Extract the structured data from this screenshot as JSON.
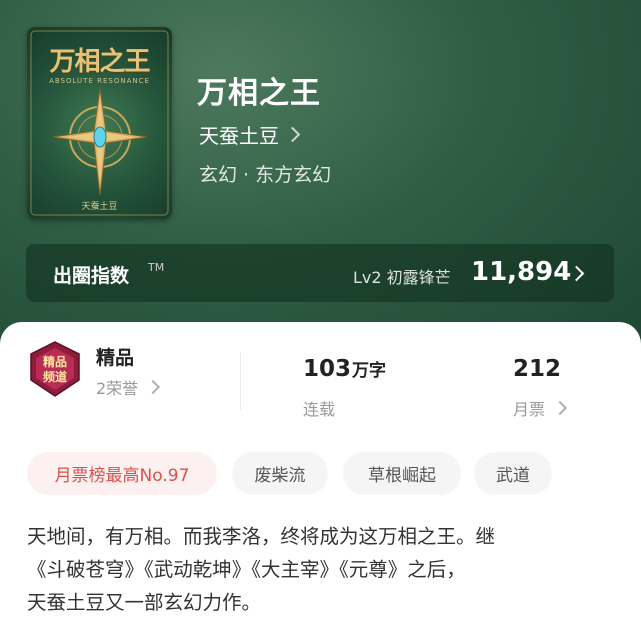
{
  "book": {
    "cover": {
      "title_art": "万相之王",
      "subtitle_art": "ABSOLUTE RESONANCE",
      "author_art": "天蚕土豆"
    },
    "title": "万相之王",
    "author": "天蚕土豆",
    "genre": "玄幻 · 东方玄幻"
  },
  "index_bar": {
    "label": "出圈指数",
    "tm": "TM",
    "level": "Lv2 初露锋芒",
    "value": "11,894"
  },
  "stats": {
    "quality": {
      "name": "精品",
      "honor": "2荣誉",
      "badge_text": "精品频道"
    },
    "word_count": {
      "number": "103",
      "unit": "万字",
      "status": "连载"
    },
    "monthly_ticket": {
      "value": "212",
      "label": "月票"
    }
  },
  "tags": [
    "月票榜最高No.97",
    "废柴流",
    "草根崛起",
    "武道"
  ],
  "intro_lines": [
    "天地间，有万相。而我李洛，终将成为这万相之王。继",
    "《斗破苍穹》《武动乾坤》《大主宰》《元尊》之后，",
    "天蚕土豆又一部玄幻力作。"
  ],
  "colors": {
    "hero_green": "#2f5d44",
    "accent_red": "#d8524c",
    "gold": "#e5c47a"
  },
  "icons": {
    "author_arrow": "chevron-right-icon",
    "index_arrow": "chevron-right-icon",
    "honor_arrow": "chevron-right-icon",
    "ticket_arrow": "chevron-right-icon",
    "badge": "quality-channel-badge-icon"
  }
}
